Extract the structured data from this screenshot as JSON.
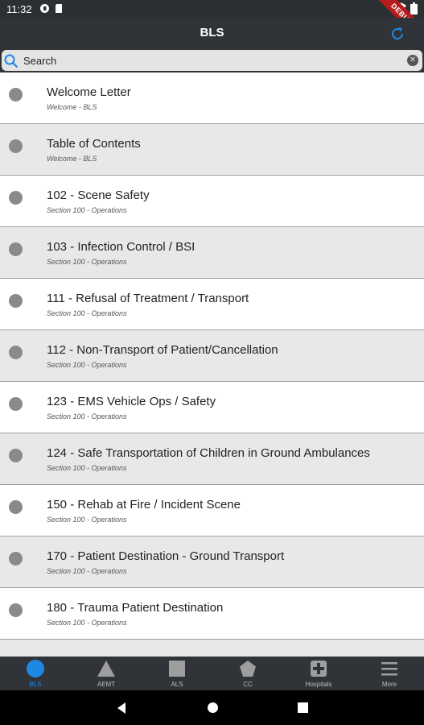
{
  "status": {
    "time": "11:32"
  },
  "debug_banner": "DEBUG",
  "appbar": {
    "title": "BLS"
  },
  "search": {
    "placeholder": "Search"
  },
  "items": [
    {
      "title": "Welcome Letter",
      "subtitle": "Welcome - BLS"
    },
    {
      "title": "Table of Contents",
      "subtitle": "Welcome - BLS"
    },
    {
      "title": "102 - Scene Safety",
      "subtitle": "Section 100 - Operations"
    },
    {
      "title": "103 - Infection Control / BSI",
      "subtitle": "Section 100 - Operations"
    },
    {
      "title": "111 - Refusal of Treatment / Transport",
      "subtitle": "Section 100 - Operations"
    },
    {
      "title": "112 - Non-Transport of Patient/Cancellation",
      "subtitle": "Section 100 - Operations"
    },
    {
      "title": "123 - EMS Vehicle Ops / Safety",
      "subtitle": "Section 100 - Operations"
    },
    {
      "title": "124 - Safe Transportation of Children in Ground Ambulances",
      "subtitle": "Section 100 - Operations"
    },
    {
      "title": "150 - Rehab at Fire / Incident Scene",
      "subtitle": "Section 100 - Operations"
    },
    {
      "title": "170 - Patient Destination - Ground Transport",
      "subtitle": "Section 100 - Operations"
    },
    {
      "title": "180 - Trauma Patient Destination",
      "subtitle": "Section 100 - Operations"
    }
  ],
  "nav": [
    {
      "label": "BLS",
      "icon": "circle-icon",
      "active": true
    },
    {
      "label": "AEMT",
      "icon": "triangle-icon",
      "active": false
    },
    {
      "label": "ALS",
      "icon": "square-icon",
      "active": false
    },
    {
      "label": "CC",
      "icon": "pentagon-icon",
      "active": false
    },
    {
      "label": "Hospitals",
      "icon": "hospital-cross-icon",
      "active": false
    },
    {
      "label": "More",
      "icon": "menu-icon",
      "active": false
    }
  ],
  "colors": {
    "accent": "#1e88e5",
    "appbar": "#303438",
    "debug": "#b71c1c"
  }
}
